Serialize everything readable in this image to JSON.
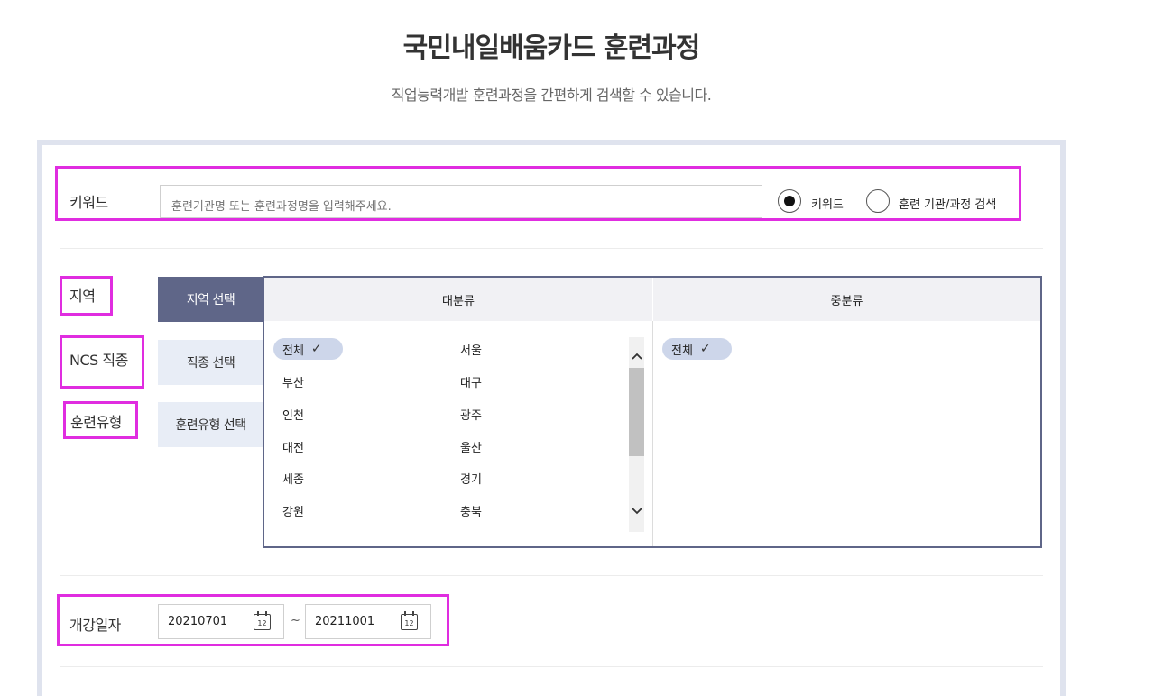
{
  "header": {
    "title": "국민내일배움카드 훈련과정",
    "subtitle": "직업능력개발 훈련과정을 간편하게 검색할 수 있습니다."
  },
  "keyword": {
    "label": "키워드",
    "placeholder": "훈련기관명 또는 훈련과정명을 입력해주세요.",
    "radio_options": [
      {
        "label": "키워드",
        "selected": true
      },
      {
        "label": "훈련 기관/과정 검색",
        "selected": false
      }
    ]
  },
  "filters": {
    "labels": {
      "region": "지역",
      "ncs": "NCS 직종",
      "training_type": "훈련유형"
    },
    "tabs": [
      {
        "label": "지역 선택",
        "active": true
      },
      {
        "label": "직종 선택",
        "active": false
      },
      {
        "label": "훈련유형 선택",
        "active": false
      }
    ]
  },
  "selector": {
    "major_header": "대분류",
    "minor_header": "중분류",
    "major_items": [
      {
        "label": "전체",
        "selected": true
      },
      {
        "label": "서울"
      },
      {
        "label": "부산"
      },
      {
        "label": "대구"
      },
      {
        "label": "인천"
      },
      {
        "label": "광주"
      },
      {
        "label": "대전"
      },
      {
        "label": "울산"
      },
      {
        "label": "세종"
      },
      {
        "label": "경기"
      },
      {
        "label": "강원"
      },
      {
        "label": "충북"
      }
    ],
    "minor_items": [
      {
        "label": "전체",
        "selected": true
      }
    ],
    "check_icon": "✓"
  },
  "start_date": {
    "label": "개강일자",
    "from": "20210701",
    "to": "20211001",
    "separator": "~",
    "calendar_icon_text": "12"
  },
  "colors": {
    "highlight": "#e02de0",
    "tab_active": "#5f6688",
    "tab_inactive": "#e8edf6",
    "chip": "#cdd6ea",
    "panel_border": "#dfe3ee"
  }
}
